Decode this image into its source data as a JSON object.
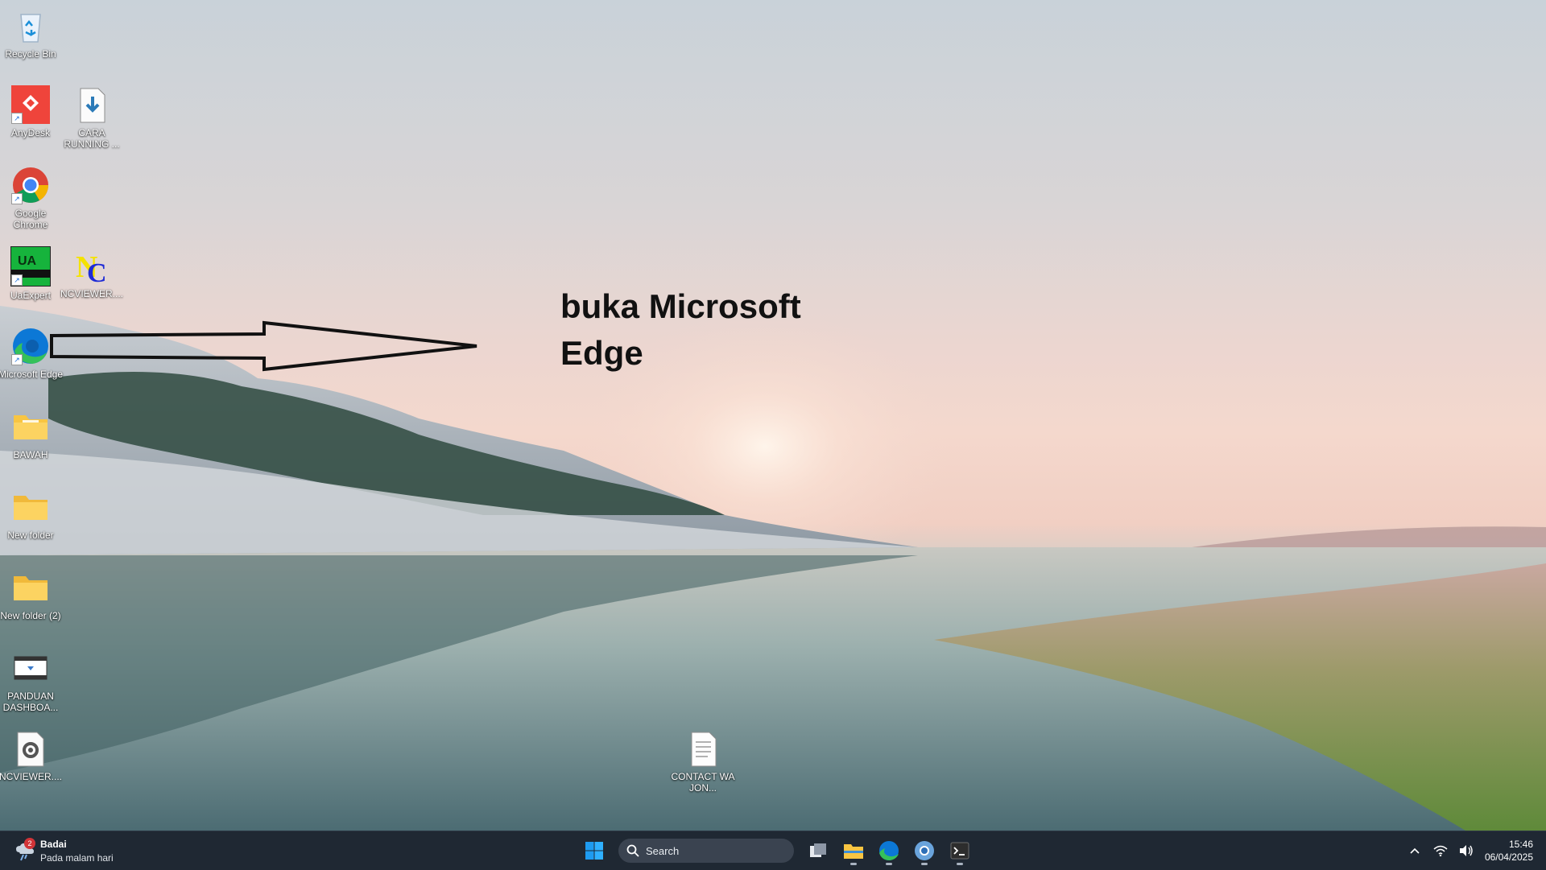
{
  "desktop": {
    "icons": [
      {
        "id": "recycle-bin",
        "label": "Recycle Bin"
      },
      {
        "id": "anydesk",
        "label": "AnyDesk"
      },
      {
        "id": "cara-running",
        "label": "CARA RUNNING ..."
      },
      {
        "id": "google-chrome",
        "label": "Google Chrome"
      },
      {
        "id": "uaexpert",
        "label": "UaExpert"
      },
      {
        "id": "ncviewer-app",
        "label": "NCVIEWER...."
      },
      {
        "id": "microsoft-edge",
        "label": "Microsoft Edge"
      },
      {
        "id": "bawah",
        "label": "BAWAH"
      },
      {
        "id": "new-folder",
        "label": "New folder"
      },
      {
        "id": "new-folder-2",
        "label": "New folder (2)"
      },
      {
        "id": "panduan",
        "label": "PANDUAN DASHBOA..."
      },
      {
        "id": "ncviewer-setting",
        "label": "NCVIEWER...."
      },
      {
        "id": "contact",
        "label": "CONTACT WA JON..."
      }
    ]
  },
  "annotation": {
    "line1": "buka Microsoft",
    "line2": "Edge"
  },
  "taskbar": {
    "weather": {
      "badge": "2",
      "title": "Badai",
      "subtitle": "Pada malam hari"
    },
    "search_placeholder": "Search",
    "pinned": [
      "windows-start",
      "task-view",
      "file-explorer",
      "microsoft-edge",
      "chromium-app",
      "terminal"
    ],
    "clock": {
      "time": "15:46",
      "date": "06/04/2025"
    }
  },
  "colors": {
    "taskbar_bg": "#1f2833",
    "edge_blue": "#0c78d6",
    "edge_green": "#35c15a",
    "folder_yellow": "#f8c542",
    "anydesk_red": "#ef443b"
  }
}
